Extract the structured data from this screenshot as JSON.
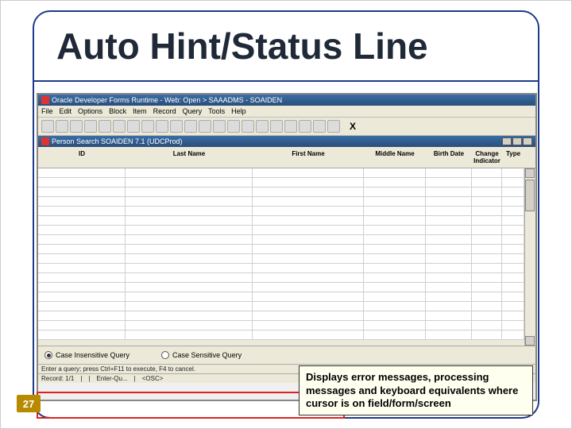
{
  "slide": {
    "title": "Auto Hint/Status Line",
    "page_number": "27"
  },
  "window": {
    "title": "Oracle Developer Forms Runtime - Web: Open > SAAADMS - SOAIDEN",
    "menu": [
      "File",
      "Edit",
      "Options",
      "Block",
      "Item",
      "Record",
      "Query",
      "Tools",
      "Help"
    ],
    "toolbar_x": "X",
    "subwindow_title": "Person Search SOAIDEN 7.1 (UDCProd)"
  },
  "columns": {
    "id": "ID",
    "last_name": "Last Name",
    "first_name": "First Name",
    "middle_name": "Middle Name",
    "birth_date": "Birth Date",
    "change_indicator": "Change Indicator",
    "type": "Type"
  },
  "radios": {
    "case_insensitive": "Case Insensitive Query",
    "case_sensitive": "Case Sensitive Query"
  },
  "status": {
    "line1": "Enter a query; press Ctrl+F11 to execute, F4 to cancel.",
    "line2_left": "Record: 1/1",
    "line2_mid": "Enter-Qu...",
    "line2_right": "<OSC>"
  },
  "callout": {
    "text": "Displays error messages, processing messages and keyboard equivalents where cursor is on field/form/screen"
  }
}
